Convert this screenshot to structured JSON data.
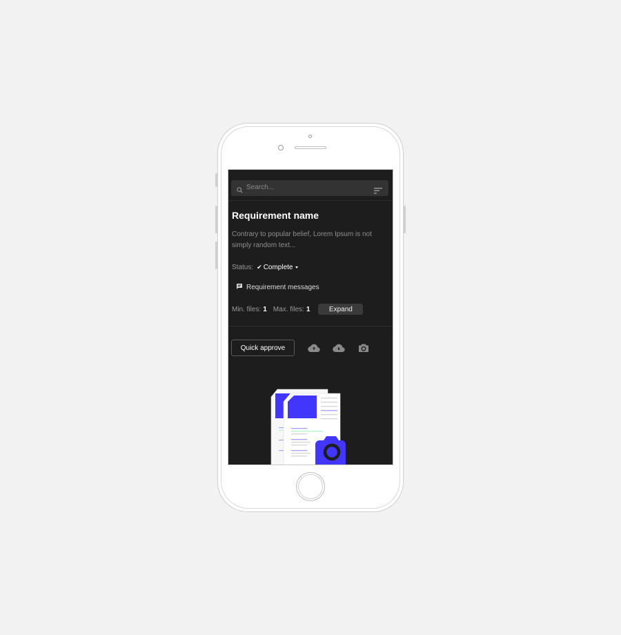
{
  "search": {
    "placeholder": "Search..."
  },
  "requirement": {
    "title": "Requirement name",
    "description": "Contrary to popular belief, Lorem Ipsum is not simply random text...",
    "status_label": "Status:",
    "status_value": "Complete",
    "messages_label": "Requirement messages",
    "min_files_label": "Min. files:",
    "min_files_value": "1",
    "max_files_label": "Max. files:",
    "max_files_value": "1",
    "expand_label": "Expand"
  },
  "actions": {
    "quick_approve_label": "Quick approve",
    "icons": [
      "cloud-upload-icon",
      "cloud-download-icon",
      "camera-icon"
    ]
  },
  "colors": {
    "accent": "#4236fc",
    "screen_bg": "#1d1d1d",
    "field_bg": "#333333",
    "highlight_green": "#b4f5d0"
  }
}
